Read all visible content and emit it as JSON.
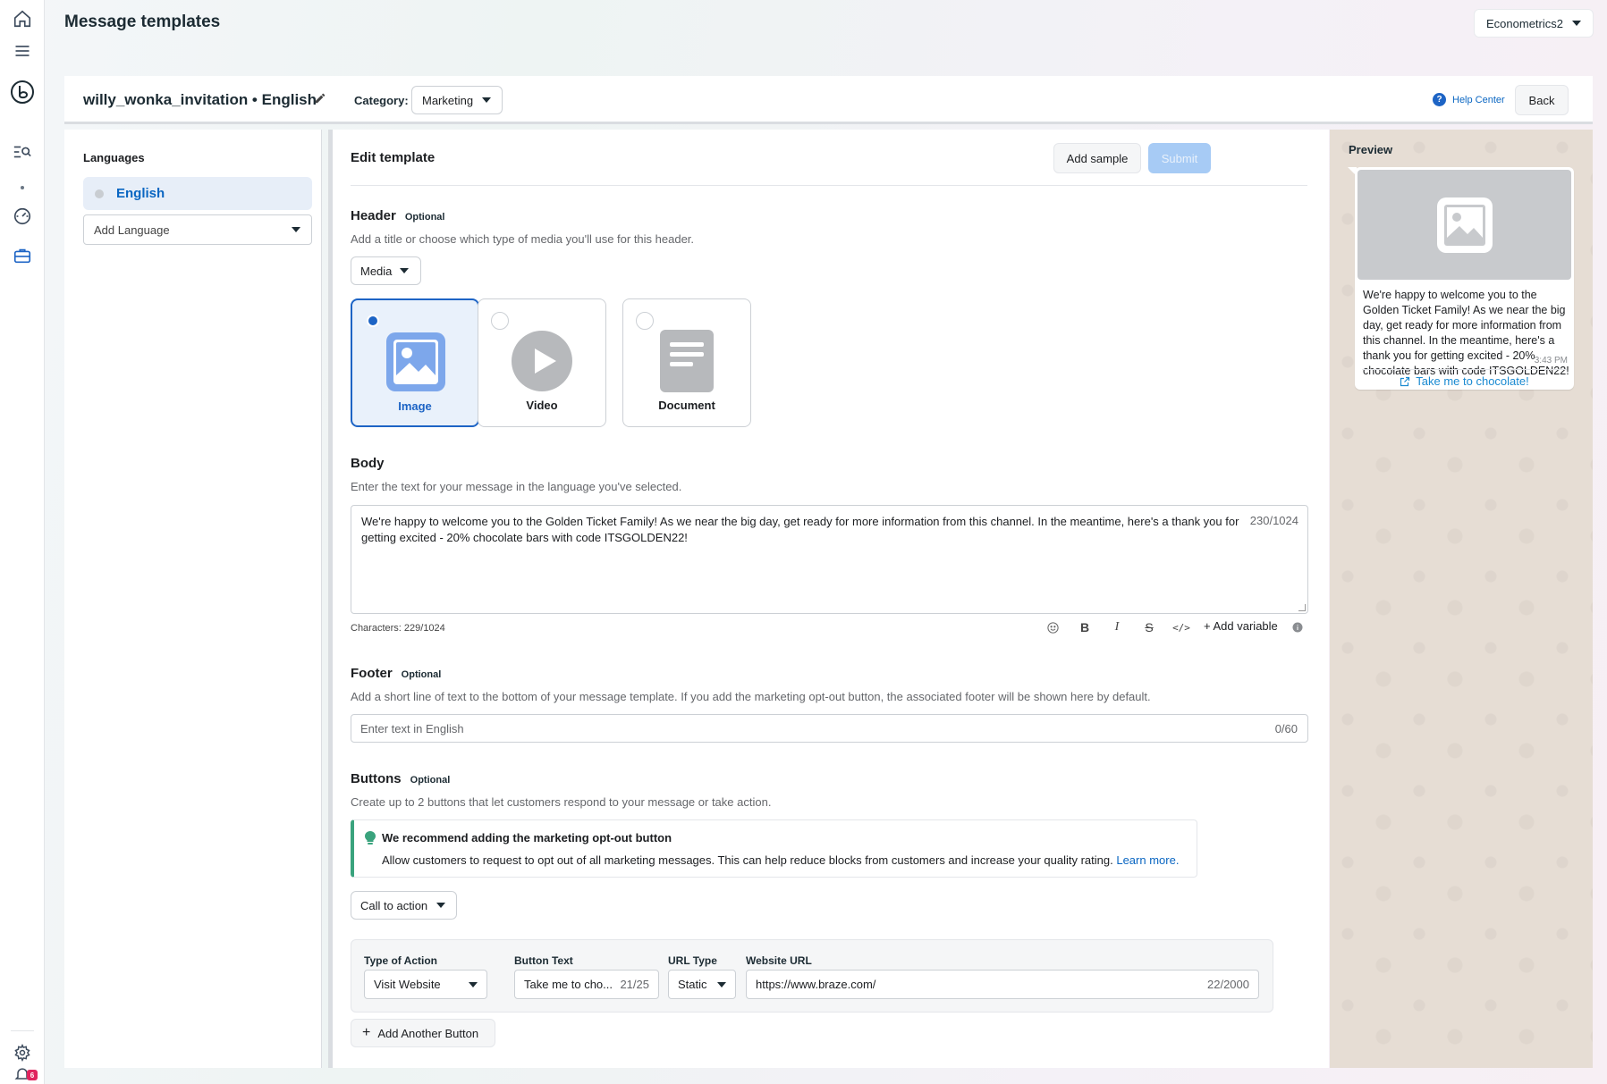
{
  "page": {
    "title": "Message templates",
    "account": "Econometrics2"
  },
  "rail": {
    "icons": [
      "home-icon",
      "menu-icon",
      "braze-logo-icon",
      "search-list-icon",
      "dashboard-icon",
      "briefcase-icon",
      "gear-icon",
      "bell-icon"
    ],
    "notification_count": "6"
  },
  "topbar": {
    "template_name": "willy_wonka_invitation • English",
    "category_label": "Category:",
    "category_value": "Marketing",
    "help_label": "Help Center",
    "back_label": "Back"
  },
  "languages": {
    "title": "Languages",
    "items": [
      {
        "label": "English"
      }
    ],
    "add_placeholder": "Add Language"
  },
  "editor": {
    "title": "Edit template",
    "add_sample": "Add sample",
    "submit": "Submit",
    "header": {
      "title": "Header",
      "optional": "Optional",
      "description": "Add a title or choose which type of media you'll use for this header.",
      "media_select": "Media",
      "options": [
        {
          "label": "Image",
          "selected": true
        },
        {
          "label": "Video",
          "selected": false
        },
        {
          "label": "Document",
          "selected": false
        }
      ]
    },
    "body": {
      "title": "Body",
      "description": "Enter the text for your message in the language you've selected.",
      "text": "We're happy to welcome you to the Golden Ticket Family! As we near the big day, get ready for more information from this channel. In the meantime, here's a thank you for getting excited - 20% chocolate bars with code ITSGOLDEN22!",
      "counter": "230/1024",
      "characters": "Characters: 229/1024",
      "add_variable": "Add variable"
    },
    "footer": {
      "title": "Footer",
      "optional": "Optional",
      "description": "Add a short line of text to the bottom of your message template. If you add the marketing opt-out button, the associated footer will be shown here by default.",
      "placeholder": "Enter text in English",
      "counter": "0/60"
    },
    "buttons": {
      "title": "Buttons",
      "optional": "Optional",
      "description": "Create up to 2 buttons that let customers respond to your message or take action.",
      "tip_title": "We recommend adding the marketing opt-out button",
      "tip_text": "Allow customers to request to opt out of all marketing messages. This can help reduce blocks from customers and increase your quality rating.",
      "tip_link": "Learn more.",
      "type_select": "Call to action",
      "fields": {
        "type_label": "Type of Action",
        "type_value": "Visit Website",
        "text_label": "Button Text",
        "text_value": "Take me to cho...",
        "text_count": "21/25",
        "url_type_label": "URL Type",
        "url_type_value": "Static",
        "url_label": "Website URL",
        "url_value": "https://www.braze.com/",
        "url_count": "22/2000"
      },
      "add_another": "Add Another Button"
    }
  },
  "preview": {
    "title": "Preview",
    "message": "We're happy to welcome you to the Golden Ticket Family! As we near the big day, get ready for more information from this channel. In the meantime, here's a thank you for getting excited - 20% chocolate bars with code ITSGOLDEN22!",
    "time": "3:43 PM",
    "cta": "Take me to chocolate!"
  },
  "colors": {
    "accent": "#1d64c5",
    "link": "#0a66c2",
    "tip_border": "#3aa37d",
    "submit_disabled": "#a7cbf5"
  }
}
